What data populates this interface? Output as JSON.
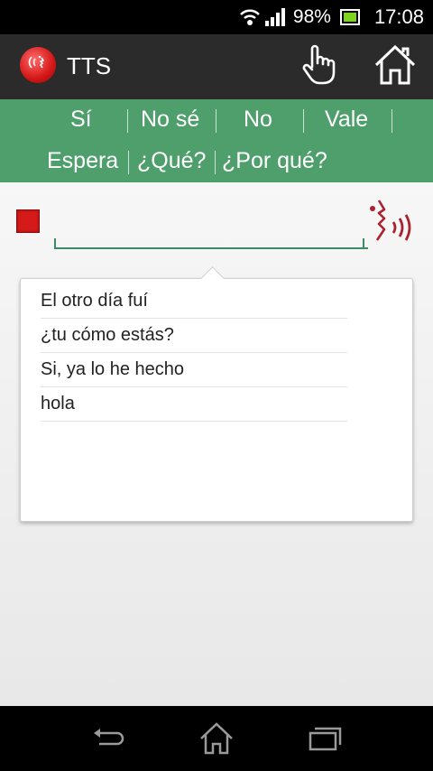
{
  "status_bar": {
    "battery": "98%",
    "time": "17:08"
  },
  "action_bar": {
    "title": "TTS",
    "icons": [
      "tts-logo-icon",
      "hand-pointer-icon",
      "home-icon"
    ]
  },
  "quick_phrases": {
    "row1": [
      "Sí",
      "No sé",
      "No",
      "Vale"
    ],
    "row2": [
      "Espera",
      "¿Qué?",
      "¿Por qué?"
    ]
  },
  "input": {
    "value": "",
    "placeholder": ""
  },
  "suggestions": [
    "El otro día fuí",
    "¿tu cómo estás?",
    "Si, ya lo he hecho",
    "hola"
  ],
  "nav_bar": {
    "icons": [
      "back-icon",
      "home-nav-icon",
      "recent-apps-icon"
    ]
  },
  "colors": {
    "accent_green": "#4f9f6d",
    "stop_red": "#d61a1a",
    "speak_red": "#a8232f"
  }
}
